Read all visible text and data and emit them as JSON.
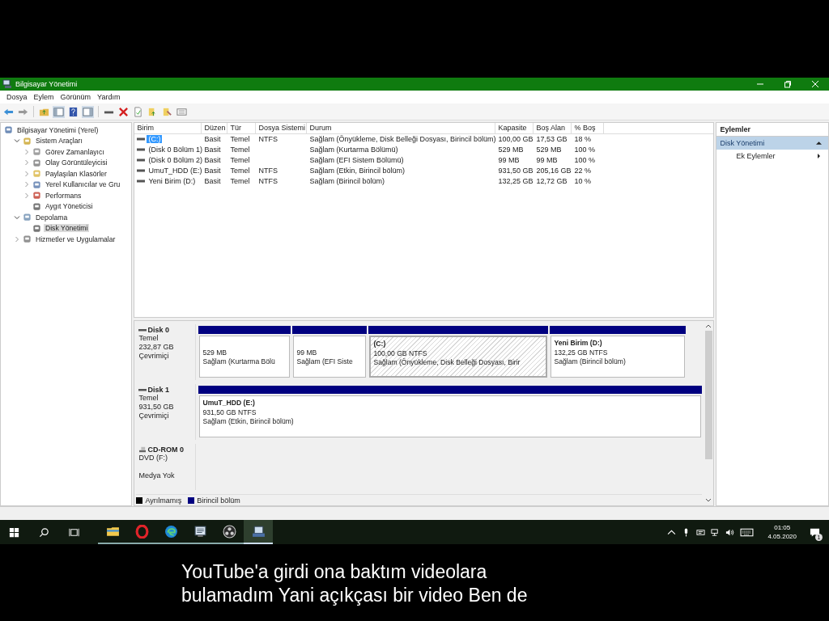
{
  "window": {
    "title": "Bilgisayar Yönetimi"
  },
  "menu": [
    "Dosya",
    "Eylem",
    "Görünüm",
    "Yardım"
  ],
  "tree": [
    {
      "label": "Bilgisayar Yönetimi (Yerel)",
      "selected": false,
      "children": [
        {
          "label": "Sistem Araçları",
          "expanded": true,
          "selected": false,
          "children": [
            {
              "label": "Görev Zamanlayıcı",
              "expanded": false,
              "selected": false
            },
            {
              "label": "Olay Görüntüleyicisi",
              "expanded": false,
              "selected": false
            },
            {
              "label": "Paylaşılan Klasörler",
              "expanded": false,
              "selected": false
            },
            {
              "label": "Yerel Kullanıcılar ve Gru",
              "expanded": false,
              "selected": false
            },
            {
              "label": "Performans",
              "expanded": false,
              "selected": false
            },
            {
              "label": "Aygıt Yöneticisi",
              "selected": false
            }
          ]
        },
        {
          "label": "Depolama",
          "expanded": true,
          "selected": false,
          "children": [
            {
              "label": "Disk Yönetimi",
              "selected": true
            }
          ]
        },
        {
          "label": "Hizmetler ve Uygulamalar",
          "expanded": false,
          "selected": false
        }
      ]
    }
  ],
  "table": {
    "columns": [
      "Birim",
      "Düzen",
      "Tür",
      "Dosya Sistemi",
      "Durum",
      "Kapasite",
      "Boş Alan",
      "% Boş"
    ],
    "rows": [
      {
        "selected": true,
        "cells": [
          "(C:)",
          "Basit",
          "Temel",
          "NTFS",
          "Sağlam (Önyükleme, Disk Belleği Dosyası, Birincil bölüm)",
          "100,00 GB",
          "17,53 GB",
          "18 %"
        ]
      },
      {
        "selected": false,
        "cells": [
          "(Disk 0 Bölüm 1)",
          "Basit",
          "Temel",
          "",
          "Sağlam (Kurtarma Bölümü)",
          "529 MB",
          "529 MB",
          "100 %"
        ]
      },
      {
        "selected": false,
        "cells": [
          "(Disk 0 Bölüm 2)",
          "Basit",
          "Temel",
          "",
          "Sağlam (EFI Sistem Bölümü)",
          "99 MB",
          "99 MB",
          "100 %"
        ]
      },
      {
        "selected": false,
        "cells": [
          "UmuT_HDD (E:)",
          "Basit",
          "Temel",
          "NTFS",
          "Sağlam (Etkin, Birincil bölüm)",
          "931,50 GB",
          "205,16 GB",
          "22 %"
        ]
      },
      {
        "selected": false,
        "cells": [
          "Yeni Birim (D:)",
          "Basit",
          "Temel",
          "NTFS",
          "Sağlam (Birincil bölüm)",
          "132,25 GB",
          "12,72 GB",
          "10 %"
        ]
      }
    ]
  },
  "disks": [
    {
      "kind": "disk",
      "name": "Disk 0",
      "lines": [
        "Temel",
        "232,87 GB",
        "Çevrimiçi"
      ],
      "partitions": [
        {
          "size": "529 MB",
          "status": "Sağlam (Kurtarma Bölü",
          "selected": false
        },
        {
          "size": "99 MB",
          "status": "Sağlam (EFI Siste",
          "selected": false
        },
        {
          "name": "(C:)",
          "size": "100,00 GB NTFS",
          "status": "Sağlam (Önyükleme, Disk Belleği Dosyası, Birir",
          "selected": true
        },
        {
          "name": "Yeni Birim  (D:)",
          "size": "132,25 GB NTFS",
          "status": "Sağlam (Birincil bölüm)",
          "selected": false
        }
      ]
    },
    {
      "kind": "disk",
      "name": "Disk 1",
      "lines": [
        "Temel",
        "931,50 GB",
        "Çevrimiçi"
      ],
      "partitions": [
        {
          "name": "UmuT_HDD  (E:)",
          "size": "931,50 GB NTFS",
          "status": "Sağlam (Etkin, Birincil bölüm)",
          "selected": false
        }
      ]
    },
    {
      "kind": "cdrom",
      "name": "CD-ROM 0",
      "lines": [
        "DVD (F:)",
        "Medya Yok"
      ]
    }
  ],
  "legend": [
    {
      "label": "Ayrılmamış",
      "color": "#000000"
    },
    {
      "label": "Birincil bölüm",
      "color": "#000080"
    }
  ],
  "actions": {
    "title": "Eylemler",
    "section": "Disk Yönetimi",
    "items": [
      "Ek Eylemler"
    ]
  },
  "taskbar": {
    "apps": [
      {
        "kind": "explorer",
        "selected": false
      },
      {
        "kind": "opera",
        "selected": false
      },
      {
        "kind": "edge",
        "selected": false
      },
      {
        "kind": "app",
        "selected": false
      },
      {
        "kind": "obs",
        "selected": false
      },
      {
        "kind": "mmc",
        "selected": true
      }
    ],
    "time": "01:05",
    "date": "4.05.2020",
    "notifications": "1"
  },
  "subtitle": [
    "YouTube'a girdi ona baktım videolara",
    "bulamadım Yani açıkçası bir video Ben de"
  ]
}
